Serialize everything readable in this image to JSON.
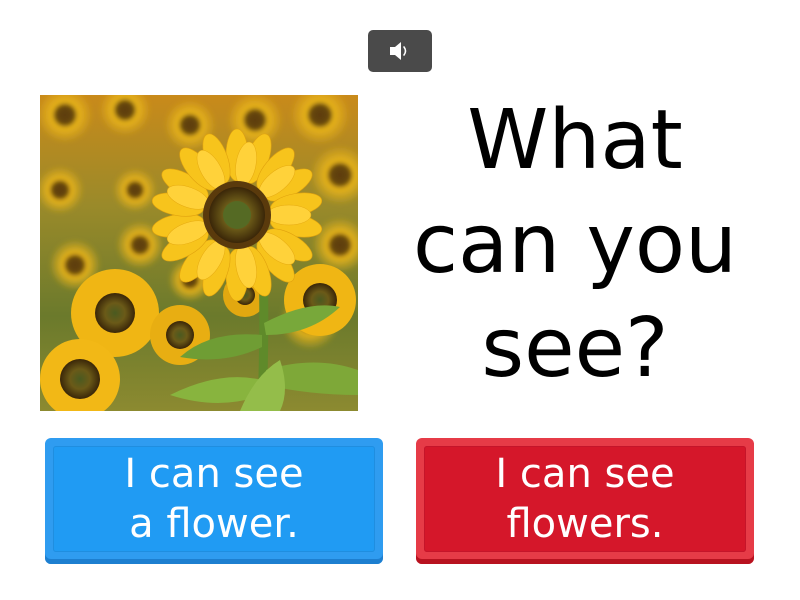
{
  "sound_button": {
    "icon": "speaker-icon",
    "bg_color": "#4a4a4a"
  },
  "picture": {
    "subject": "sunflower-field-image"
  },
  "question": {
    "line1": "What",
    "line2": "can you",
    "line3": "see?"
  },
  "answers": [
    {
      "line1": "I can see",
      "line2": "a flower.",
      "color": "#209bf3"
    },
    {
      "line1": "I can see",
      "line2": "flowers.",
      "color": "#d5172a"
    }
  ]
}
